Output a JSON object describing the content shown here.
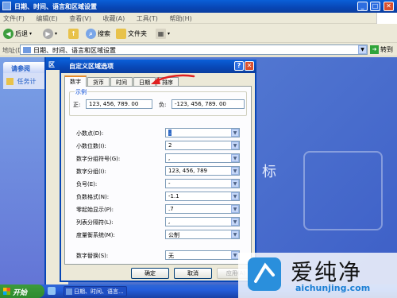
{
  "window": {
    "title": "日期、时间、语言和区域设置"
  },
  "menu": [
    "文件(F)",
    "编辑(E)",
    "查看(V)",
    "收藏(A)",
    "工具(T)",
    "帮助(H)"
  ],
  "toolbar": {
    "back": "后退",
    "search": "搜索",
    "folders": "文件夹"
  },
  "address": {
    "label": "地址(D)",
    "value": "日期、时间、语言和区域设置",
    "go": "转到"
  },
  "tasks_pane": {
    "title": "请参阅",
    "item": "任务计"
  },
  "parent_dialog": {
    "title_fragment": "区"
  },
  "background": {
    "char": "标"
  },
  "dialog": {
    "title": "自定义区域选项",
    "help": "?",
    "close": "✕",
    "tabs": [
      "数字",
      "货币",
      "时间",
      "日期",
      "排序"
    ],
    "active_tab": "数字",
    "sample": {
      "legend": "示例",
      "positive_label": "正:",
      "positive_value": "123, 456, 789. 00",
      "negative_label": "负:",
      "negative_value": "-123, 456, 789. 00"
    },
    "rows": [
      {
        "label": "小数点(D):",
        "value": "."
      },
      {
        "label": "小数位数(I):",
        "value": "2"
      },
      {
        "label": "数字分组符号(G):",
        "value": ","
      },
      {
        "label": "数字分组(I):",
        "value": "123, 456, 789"
      },
      {
        "label": "负号(E):",
        "value": "-"
      },
      {
        "label": "负数格式(N):",
        "value": "-1.1"
      },
      {
        "label": "零起始显示(P):",
        "value": ".7"
      },
      {
        "label": "列表分隔符(L):",
        "value": ","
      },
      {
        "label": "度量衡系统(M):",
        "value": "公制"
      },
      {
        "label": "数字替换(S):",
        "value": "无"
      }
    ],
    "buttons": {
      "ok": "确定",
      "cancel": "取消",
      "apply": "应用(A)"
    }
  },
  "taskbar": {
    "start": "开始",
    "task": "日期、时间、语言..."
  },
  "watermark": {
    "zh": "爱纯净",
    "url": "aichunjing.com"
  }
}
